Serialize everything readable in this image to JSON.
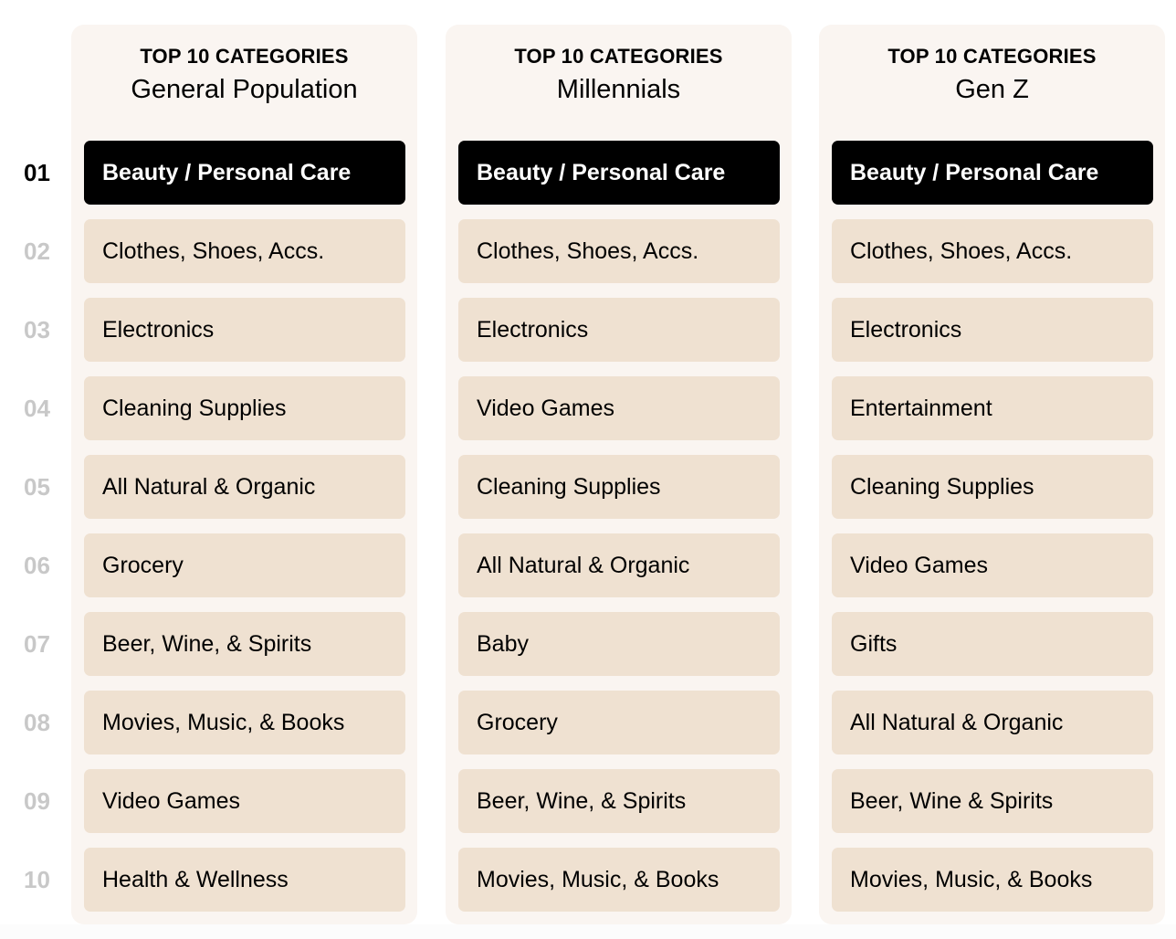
{
  "kicker": "TOP 10 CATEGORIES",
  "ranks": [
    "01",
    "02",
    "03",
    "04",
    "05",
    "06",
    "07",
    "08",
    "09",
    "10"
  ],
  "colors": {
    "panel_bg": "#faf5f1",
    "item_bg": "#efe1d1",
    "top_item_bg": "#000000",
    "rank_muted": "#c8c8c8"
  },
  "columns": [
    {
      "title": "General Population",
      "items": [
        "Beauty / Personal Care",
        "Clothes, Shoes, Accs.",
        "Electronics",
        "Cleaning Supplies",
        "All Natural & Organic",
        "Grocery",
        "Beer, Wine, & Spirits",
        "Movies, Music, & Books",
        "Video Games",
        "Health & Wellness"
      ]
    },
    {
      "title": "Millennials",
      "items": [
        "Beauty / Personal Care",
        "Clothes, Shoes, Accs.",
        "Electronics",
        "Video Games",
        "Cleaning Supplies",
        "All Natural & Organic",
        "Baby",
        "Grocery",
        "Beer, Wine, & Spirits",
        "Movies, Music, & Books"
      ]
    },
    {
      "title": "Gen Z",
      "items": [
        "Beauty / Personal Care",
        "Clothes, Shoes, Accs.",
        "Electronics",
        "Entertainment",
        "Cleaning Supplies",
        "Video Games",
        "Gifts",
        "All Natural & Organic",
        "Beer, Wine & Spirits",
        "Movies, Music, & Books"
      ]
    }
  ]
}
